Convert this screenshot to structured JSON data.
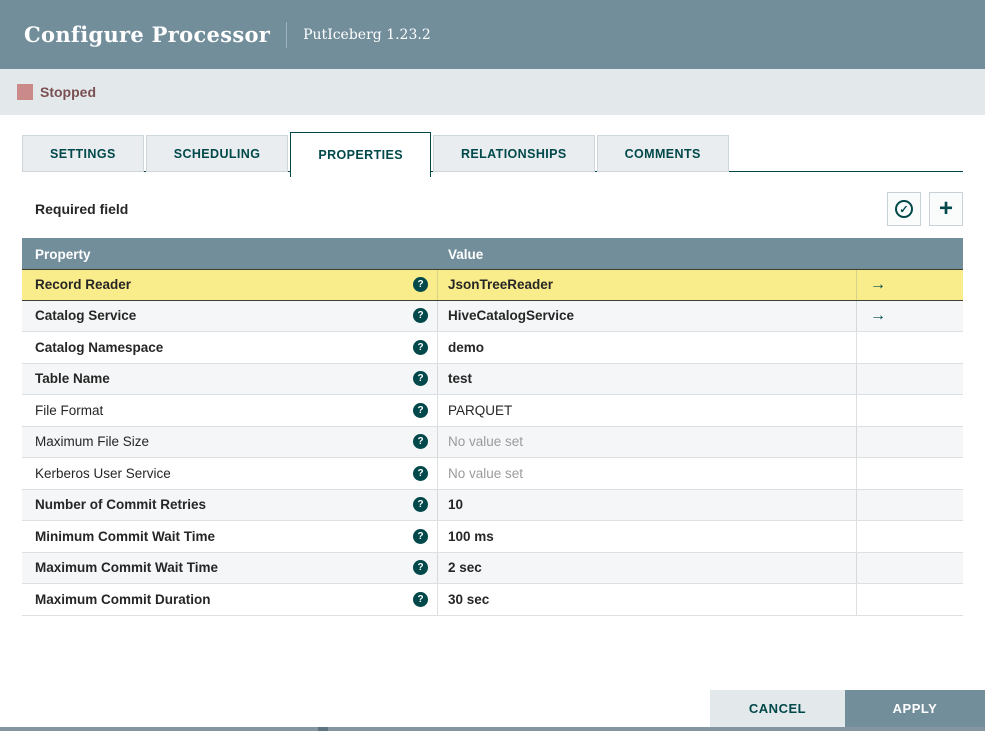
{
  "header": {
    "title": "Configure Processor",
    "subtitle": "PutIceberg 1.23.2"
  },
  "status": {
    "label": "Stopped"
  },
  "tabs": [
    {
      "label": "SETTINGS"
    },
    {
      "label": "SCHEDULING"
    },
    {
      "label": "PROPERTIES",
      "active": true
    },
    {
      "label": "RELATIONSHIPS"
    },
    {
      "label": "COMMENTS"
    }
  ],
  "toolbar": {
    "required_label": "Required field"
  },
  "icons": {
    "help": "?",
    "check": "✓",
    "plus": "+",
    "goto": "→"
  },
  "table": {
    "columns": {
      "property": "Property",
      "value": "Value"
    },
    "rows": [
      {
        "property": "Record Reader",
        "value": "JsonTreeReader",
        "bold": true,
        "selected": true,
        "goto": true
      },
      {
        "property": "Catalog Service",
        "value": "HiveCatalogService",
        "bold": true,
        "goto": true
      },
      {
        "property": "Catalog Namespace",
        "value": "demo",
        "bold": true
      },
      {
        "property": "Table Name",
        "value": "test",
        "bold": true
      },
      {
        "property": "File Format",
        "value": "PARQUET",
        "bold": false
      },
      {
        "property": "Maximum File Size",
        "value": "No value set",
        "bold": false,
        "unset": true
      },
      {
        "property": "Kerberos User Service",
        "value": "No value set",
        "bold": false,
        "unset": true
      },
      {
        "property": "Number of Commit Retries",
        "value": "10",
        "bold": true
      },
      {
        "property": "Minimum Commit Wait Time",
        "value": "100 ms",
        "bold": true
      },
      {
        "property": "Maximum Commit Wait Time",
        "value": "2 sec",
        "bold": true
      },
      {
        "property": "Maximum Commit Duration",
        "value": "30 sec",
        "bold": true
      }
    ]
  },
  "footer": {
    "cancel_label": "CANCEL",
    "apply_label": "APPLY"
  },
  "colors": {
    "accent": "#004849",
    "header": "#728E9B",
    "status_bar": "#E3E8EB",
    "selected_row": "#F9EC8A",
    "stopped_square": "#CA8A8A",
    "unset_text": "#9B9B9B"
  }
}
